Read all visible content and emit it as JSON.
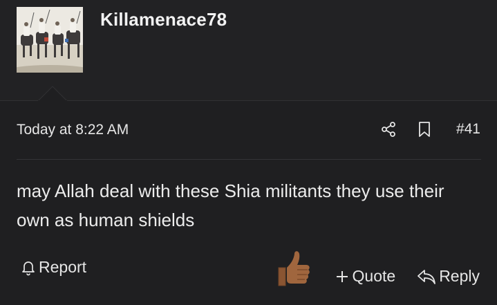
{
  "author": {
    "username": "Killamenace78",
    "avatar_icon": "horsemen-photo-avatar"
  },
  "post": {
    "timestamp": "Today at 8:22 AM",
    "number": "#41",
    "message": "may Allah deal with these Shia militants they use their own as human shields"
  },
  "actions": {
    "share_icon": "share-icon",
    "bookmark_icon": "bookmark-icon",
    "report_label": "Report",
    "quote_label": "Quote",
    "reply_label": "Reply",
    "reaction_icon": "thumbs-up-icon"
  },
  "colors": {
    "background": "#222224",
    "post_background": "#1f1f21",
    "text": "#e8e8e8",
    "reaction_skin": "#a0663e"
  }
}
